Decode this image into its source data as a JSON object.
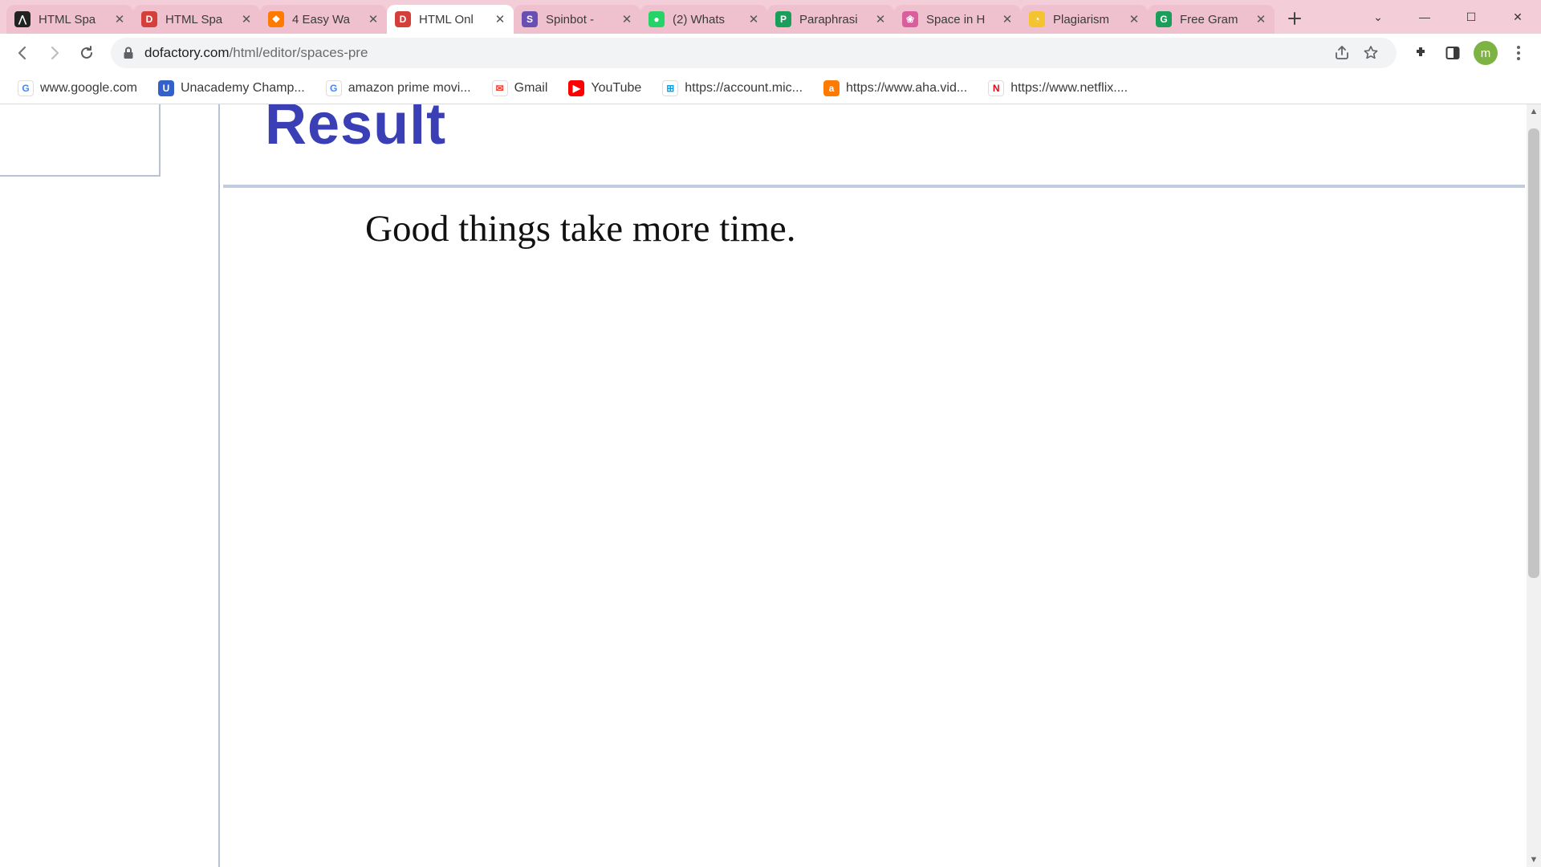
{
  "tabs": [
    {
      "label": "HTML Spa",
      "favicon_bg": "#222222",
      "favicon_txt": "⋀"
    },
    {
      "label": "HTML Spa",
      "favicon_bg": "#d43f3a",
      "favicon_txt": "D"
    },
    {
      "label": "4 Easy Wa",
      "favicon_bg": "#ff7a00",
      "favicon_txt": "❖"
    },
    {
      "label": "HTML Onl",
      "favicon_bg": "#d43f3a",
      "favicon_txt": "D",
      "active": true
    },
    {
      "label": "Spinbot -",
      "favicon_bg": "#6a4fb3",
      "favicon_txt": "S"
    },
    {
      "label": "(2) Whats",
      "favicon_bg": "#25d366",
      "favicon_txt": "●"
    },
    {
      "label": "Paraphrasi",
      "favicon_bg": "#1b9e5a",
      "favicon_txt": "P"
    },
    {
      "label": "Space in H",
      "favicon_bg": "#d85f9c",
      "favicon_txt": "❀"
    },
    {
      "label": "Plagiarism",
      "favicon_bg": "#f4c430",
      "favicon_txt": "◔"
    },
    {
      "label": "Free Gram",
      "favicon_bg": "#1b9e5a",
      "favicon_txt": "G"
    }
  ],
  "window_controls": {
    "chevron": "⌄",
    "minimize": "—",
    "maximize": "☐",
    "close": "✕"
  },
  "toolbar": {
    "url_host": "dofactory.com",
    "url_path": "/html/editor/spaces-pre",
    "avatar_initial": "m"
  },
  "bookmarks": [
    {
      "label": "www.google.com",
      "icon_bg": "#ffffff",
      "icon_txt": "G",
      "icon_color": "#4285f4",
      "border": true
    },
    {
      "label": "Unacademy Champ...",
      "icon_bg": "#3361c9",
      "icon_txt": "U"
    },
    {
      "label": "amazon prime movi...",
      "icon_bg": "#ffffff",
      "icon_txt": "G",
      "icon_color": "#4285f4",
      "border": true
    },
    {
      "label": "Gmail",
      "icon_bg": "#ffffff",
      "icon_txt": "✉",
      "icon_color": "#ea4335",
      "border": true
    },
    {
      "label": "YouTube",
      "icon_bg": "#ff0000",
      "icon_txt": "▶"
    },
    {
      "label": "https://account.mic...",
      "icon_bg": "#ffffff",
      "icon_txt": "⊞",
      "icon_color": "#00a4ef",
      "border": true
    },
    {
      "label": "https://www.aha.vid...",
      "icon_bg": "#ff7a00",
      "icon_txt": "a"
    },
    {
      "label": "https://www.netflix....",
      "icon_bg": "#ffffff",
      "icon_txt": "N",
      "icon_color": "#e50914",
      "border": true
    }
  ],
  "page": {
    "heading": "Result",
    "body_text": "Good things take  more time."
  }
}
